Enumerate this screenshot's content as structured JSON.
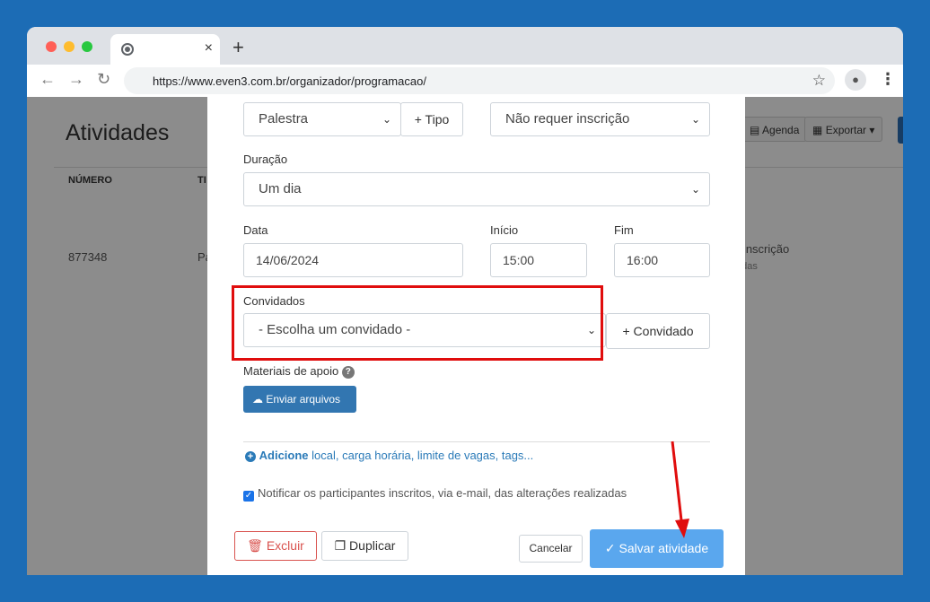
{
  "browser": {
    "new_tab_symbol": "+",
    "tab_close_symbol": "×",
    "url": "https://www.even3.com.br/organizador/programacao/",
    "nav": {
      "back": "←",
      "forward": "→",
      "reload": "↻"
    },
    "star_symbol": "☆",
    "menu_symbol": "⋮"
  },
  "page": {
    "title": "Atividades",
    "buttons": {
      "agenda": "Agenda",
      "exportar": "Exportar ▾"
    },
    "table": {
      "headers": [
        "NÚMERO",
        "TI"
      ],
      "row": {
        "numero": "877348",
        "tipo": "Pa",
        "inscricao": "r inscrição",
        "sub": "adas"
      }
    }
  },
  "modal": {
    "tipo_select": "Palestra",
    "tipo_button": "+ Tipo",
    "inscricao_select": "Não requer inscrição",
    "duracao_label": "Duração",
    "duracao_select": "Um dia",
    "data_label": "Data",
    "data_value": "14/06/2024",
    "inicio_label": "Início",
    "inicio_value": "15:00",
    "fim_label": "Fim",
    "fim_value": "16:00",
    "convidados_label": "Convidados",
    "convidados_select": "- Escolha um convidado -",
    "convidado_button": "+ Convidado",
    "materiais_label": "Materiais de apoio",
    "help_symbol": "?",
    "upload_button": "Enviar arquivos",
    "add_more_bold": "Adicione",
    "add_more_rest": " local, carga horária, limite de vagas, tags...",
    "notify_text": "Notificar os participantes inscritos, via e-mail, das alterações realizadas",
    "excluir_button": "Excluir",
    "duplicar_button": "Duplicar",
    "cancelar_button": "Cancelar",
    "salvar_button": "Salvar atividade"
  },
  "colors": {
    "background": "#1c6cb5",
    "primary": "#3276b1",
    "save": "#5aa7ee",
    "danger": "#d9534f",
    "annotation": "#e00d0d"
  }
}
